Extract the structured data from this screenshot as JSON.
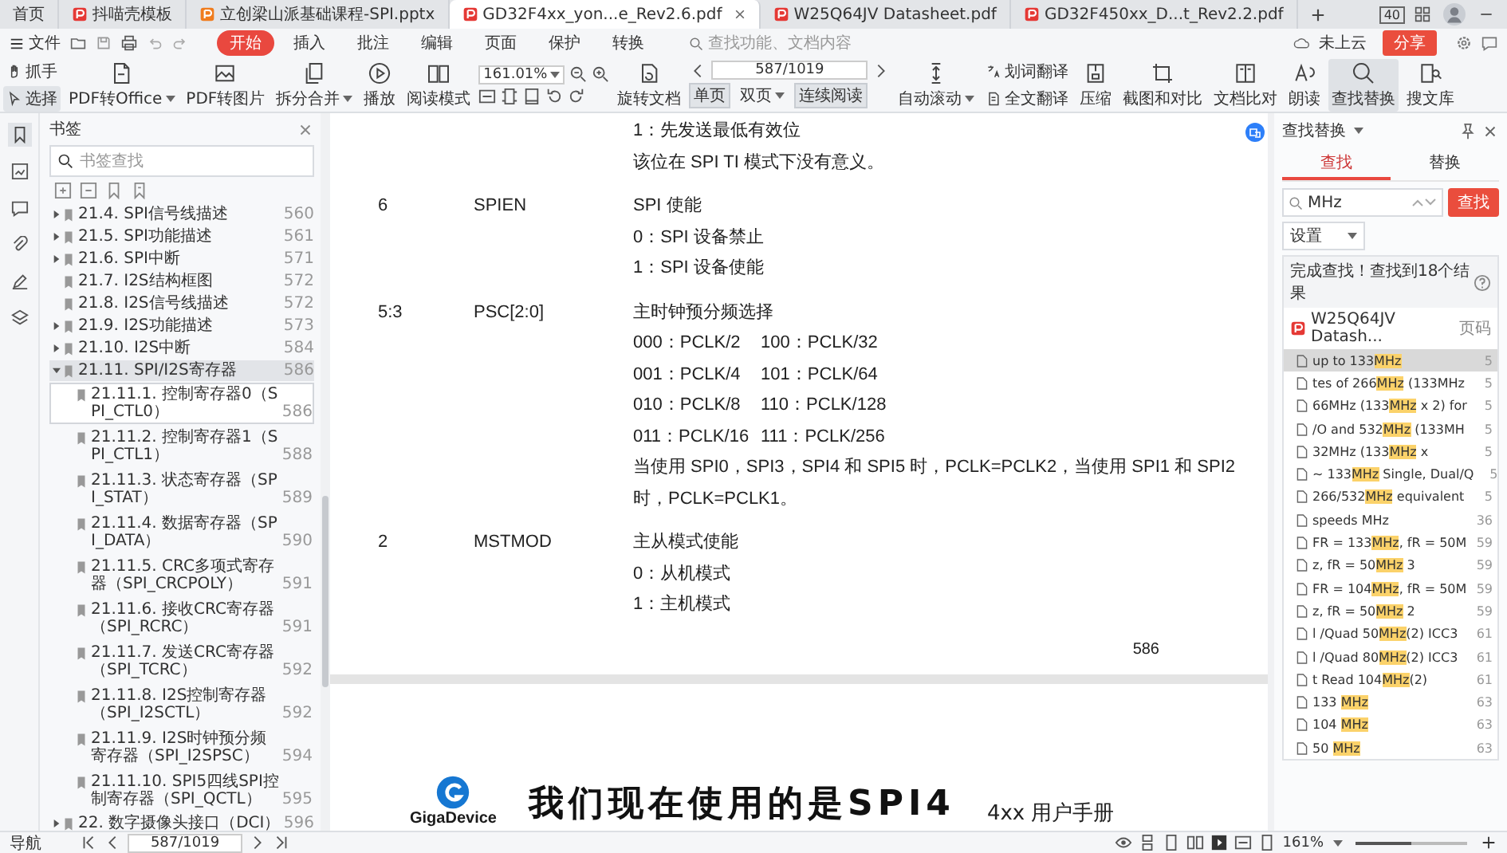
{
  "tabs": [
    {
      "label": "首页",
      "kind": "home",
      "selected": false
    },
    {
      "label": "抖喵壳模板",
      "kind": "template",
      "selected": false
    },
    {
      "label": "立创梁山派基础课程-SPI.pptx",
      "kind": "ppt",
      "selected": false
    },
    {
      "label": "GD32F4xx_yon...e_Rev2.6.pdf",
      "kind": "pdf",
      "selected": true
    },
    {
      "label": "W25Q64JV Datasheet.pdf",
      "kind": "pdf",
      "selected": false
    },
    {
      "label": "GD32F450xx_D...t_Rev2.2.pdf",
      "kind": "pdf",
      "selected": false
    }
  ],
  "window_badge": "40",
  "menu": {
    "file": "文件",
    "items": [
      {
        "label": "开始",
        "selected": true
      },
      {
        "label": "插入",
        "selected": false
      },
      {
        "label": "批注",
        "selected": false
      },
      {
        "label": "编辑",
        "selected": false
      },
      {
        "label": "页面",
        "selected": false
      },
      {
        "label": "保护",
        "selected": false
      },
      {
        "label": "转换",
        "selected": false
      }
    ],
    "search_placeholder": "查找功能、文档内容",
    "cloud": "未上云",
    "share": "分享"
  },
  "toolbar": [
    {
      "kind": "stack",
      "rows": [
        {
          "label": "抓手",
          "selected": false
        },
        {
          "label": "选择",
          "selected": true
        }
      ]
    },
    {
      "kind": "big",
      "label": "PDF转Office",
      "dropdown": true,
      "active": false
    },
    {
      "kind": "big",
      "label": "PDF转图片",
      "dropdown": false,
      "active": false
    },
    {
      "kind": "big",
      "label": "拆分合并",
      "dropdown": true,
      "active": false
    },
    {
      "kind": "big",
      "label": "播放",
      "dropdown": false,
      "active": false
    },
    {
      "kind": "big",
      "label": "阅读模式",
      "dropdown": false,
      "active": false
    },
    {
      "kind": "zoom",
      "value": "161.01%"
    },
    {
      "kind": "big",
      "label": "旋转文档",
      "dropdown": false,
      "active": false
    },
    {
      "kind": "page",
      "value": "587/1019",
      "modes": [
        {
          "label": "单页",
          "dropdown": false,
          "selected": true
        },
        {
          "label": "双页",
          "dropdown": true,
          "selected": false
        },
        {
          "label": "连续阅读",
          "dropdown": false,
          "selected": true
        }
      ]
    },
    {
      "kind": "big",
      "label": "自动滚动",
      "dropdown": true,
      "active": false
    },
    {
      "kind": "stack",
      "rows": [
        {
          "label": "划词翻译",
          "selected": false
        },
        {
          "label": "全文翻译",
          "selected": false
        }
      ]
    },
    {
      "kind": "big",
      "label": "压缩",
      "dropdown": false,
      "active": false
    },
    {
      "kind": "big",
      "label": "截图和对比",
      "dropdown": false,
      "active": false
    },
    {
      "kind": "big",
      "label": "文档比对",
      "dropdown": false,
      "active": false
    },
    {
      "kind": "big",
      "label": "朗读",
      "dropdown": false,
      "active": false
    },
    {
      "kind": "big",
      "label": "查找替换",
      "dropdown": false,
      "active": true
    },
    {
      "kind": "big",
      "label": "搜文库",
      "dropdown": false,
      "active": false
    }
  ],
  "sidebar": {
    "title": "书签",
    "search_placeholder": "书签查找",
    "items": [
      {
        "label": "21.4. SPI信号线描述",
        "page": "560",
        "expandable": true,
        "selected": false
      },
      {
        "label": "21.5. SPI功能描述",
        "page": "561",
        "expandable": true,
        "selected": false
      },
      {
        "label": "21.6. SPI中断",
        "page": "571",
        "expandable": true,
        "selected": false
      },
      {
        "label": "21.7. I2S结构框图",
        "page": "572",
        "expandable": false,
        "selected": false
      },
      {
        "label": "21.8. I2S信号线描述",
        "page": "572",
        "expandable": false,
        "selected": false
      },
      {
        "label": "21.9. I2S功能描述",
        "page": "573",
        "expandable": true,
        "selected": false
      },
      {
        "label": "21.10. I2S中断",
        "page": "584",
        "expandable": true,
        "selected": false
      },
      {
        "label": "21.11. SPI/I2S寄存器",
        "page": "586",
        "expandable": true,
        "selected": true,
        "children": [
          {
            "label": "21.11.1. 控制寄存器0（SPI_CTL0）",
            "page": "586",
            "selected": true
          },
          {
            "label": "21.11.2. 控制寄存器1（SPI_CTL1）",
            "page": "588",
            "selected": false
          },
          {
            "label": "21.11.3. 状态寄存器（SPI_STAT）",
            "page": "589",
            "selected": false
          },
          {
            "label": "21.11.4. 数据寄存器（SPI_DATA）",
            "page": "590",
            "selected": false
          },
          {
            "label": "21.11.5. CRC多项式寄存器（SPI_CRCPOLY）",
            "page": "591",
            "selected": false
          },
          {
            "label": "21.11.6. 接收CRC寄存器（SPI_RCRC）",
            "page": "591",
            "selected": false
          },
          {
            "label": "21.11.7. 发送CRC寄存器（SPI_TCRC）",
            "page": "592",
            "selected": false
          },
          {
            "label": "21.11.8. I2S控制寄存器（SPI_I2SCTL）",
            "page": "592",
            "selected": false
          },
          {
            "label": "21.11.9. I2S时钟预分频寄存器（SPI_I2SPSC）",
            "page": "594",
            "selected": false
          },
          {
            "label": "21.11.10. SPI5四线SPI控制寄存器（SPI_QCTL）",
            "page": "595",
            "selected": false
          }
        ]
      }
    ],
    "next_chapter": {
      "label": "22. 数字摄像头接口（DCI）",
      "page": "596",
      "expandable": true
    }
  },
  "document": {
    "rows": [
      {
        "lines": [
          "1：先发送最低有效位",
          "该位在 SPI TI 模式下没有意义。"
        ]
      },
      {
        "bits": "6",
        "name": "SPIEN",
        "lines": [
          "SPI 使能",
          "0：SPI 设备禁止",
          "1：SPI 设备使能"
        ]
      },
      {
        "bits": "5:3",
        "name": "PSC[2:0]",
        "lines": [
          "主时钟预分频选择",
          [
            "000：PCLK/2",
            "100：PCLK/32"
          ],
          [
            "001：PCLK/4",
            "101：PCLK/64"
          ],
          [
            "010：PCLK/8",
            "110：PCLK/128"
          ],
          [
            "011：PCLK/16",
            "111：PCLK/256"
          ],
          "当使用 SPI0，SPI3，SPI4 和 SPI5 时，PCLK=PCLK2，当使用 SPI1 和 SPI2 时，PCLK=PCLK1。"
        ]
      },
      {
        "bits": "2",
        "name": "MSTMOD",
        "lines": [
          "主从模式使能",
          "0：从机模式",
          "1：主机模式"
        ]
      }
    ],
    "page_number": "586",
    "logo": "GigaDevice",
    "subtitle": "我们现在使用的是SPI4",
    "header": "4xx 用户手册"
  },
  "find": {
    "title": "查找替换",
    "tabs": [
      {
        "label": "查找",
        "selected": true
      },
      {
        "label": "替换",
        "selected": false
      }
    ],
    "query": "MHz",
    "button": "查找",
    "settings": "设置",
    "summary": "完成查找！查找到18个结果",
    "file": "W25Q64JV Datash...",
    "page_header": "页码",
    "results": [
      {
        "parts": [
          {
            "t": "up to 133",
            "hit": false
          },
          {
            "t": "MHz",
            "hit": true
          }
        ],
        "page": "5",
        "selected": true
      },
      {
        "parts": [
          {
            "t": "tes of 266",
            "hit": false
          },
          {
            "t": "MHz",
            "hit": true
          },
          {
            "t": " (133MHz",
            "hit": false
          }
        ],
        "page": "5",
        "selected": false
      },
      {
        "parts": [
          {
            "t": "66MHz (133",
            "hit": false
          },
          {
            "t": "MHz",
            "hit": true
          },
          {
            "t": " x 2) for",
            "hit": false
          }
        ],
        "page": "5",
        "selected": false
      },
      {
        "parts": [
          {
            "t": "/O and 532",
            "hit": false
          },
          {
            "t": "MHz",
            "hit": true
          },
          {
            "t": " (133MH",
            "hit": false
          }
        ],
        "page": "5",
        "selected": false
      },
      {
        "parts": [
          {
            "t": "32MHz (133",
            "hit": false
          },
          {
            "t": "MHz",
            "hit": true
          },
          {
            "t": " x",
            "hit": false
          }
        ],
        "page": "5",
        "selected": false
      },
      {
        "parts": [
          {
            "t": "~ 133",
            "hit": false
          },
          {
            "t": "MHz",
            "hit": true
          },
          {
            "t": " Single, Dual/Q",
            "hit": false
          }
        ],
        "page": "5",
        "selected": false
      },
      {
        "parts": [
          {
            "t": "266/532",
            "hit": false
          },
          {
            "t": "MHz",
            "hit": true
          },
          {
            "t": " equivalent",
            "hit": false
          }
        ],
        "page": "5",
        "selected": false
      },
      {
        "parts": [
          {
            "t": "speeds MHz",
            "hit": false
          }
        ],
        "page": "36",
        "selected": false
      },
      {
        "parts": [
          {
            "t": "FR = 133",
            "hit": false
          },
          {
            "t": "MHz",
            "hit": true
          },
          {
            "t": ", fR = 50M",
            "hit": false
          }
        ],
        "page": "59",
        "selected": false
      },
      {
        "parts": [
          {
            "t": "z, fR = 50",
            "hit": false
          },
          {
            "t": "MHz",
            "hit": true
          },
          {
            "t": " 3",
            "hit": false
          }
        ],
        "page": "59",
        "selected": false
      },
      {
        "parts": [
          {
            "t": "FR = 104",
            "hit": false
          },
          {
            "t": "MHz",
            "hit": true
          },
          {
            "t": ", fR = 50M",
            "hit": false
          }
        ],
        "page": "59",
        "selected": false
      },
      {
        "parts": [
          {
            "t": "z, fR = 50",
            "hit": false
          },
          {
            "t": "MHz",
            "hit": true
          },
          {
            "t": " 2",
            "hit": false
          }
        ],
        "page": "59",
        "selected": false
      },
      {
        "parts": [
          {
            "t": "l /Quad 50",
            "hit": false
          },
          {
            "t": "MHz",
            "hit": true
          },
          {
            "t": "(2) ICC3",
            "hit": false
          }
        ],
        "page": "61",
        "selected": false
      },
      {
        "parts": [
          {
            "t": "l /Quad 80",
            "hit": false
          },
          {
            "t": "MHz",
            "hit": true
          },
          {
            "t": "(2) ICC3",
            "hit": false
          }
        ],
        "page": "61",
        "selected": false
      },
      {
        "parts": [
          {
            "t": "t Read 104",
            "hit": false
          },
          {
            "t": "MHz",
            "hit": true
          },
          {
            "t": "(2)",
            "hit": false
          }
        ],
        "page": "61",
        "selected": false
      },
      {
        "parts": [
          {
            "t": "133 ",
            "hit": false
          },
          {
            "t": "MHz",
            "hit": true
          }
        ],
        "page": "63",
        "selected": false
      },
      {
        "parts": [
          {
            "t": "104 ",
            "hit": false
          },
          {
            "t": "MHz",
            "hit": true
          }
        ],
        "page": "63",
        "selected": false
      },
      {
        "parts": [
          {
            "t": "50 ",
            "hit": false
          },
          {
            "t": "MHz",
            "hit": true
          }
        ],
        "page": "63",
        "selected": false
      }
    ]
  },
  "status": {
    "nav": "导航",
    "page": "587/1019",
    "zoom": "161%",
    "zoom_slider": {
      "level": 0.5
    }
  }
}
